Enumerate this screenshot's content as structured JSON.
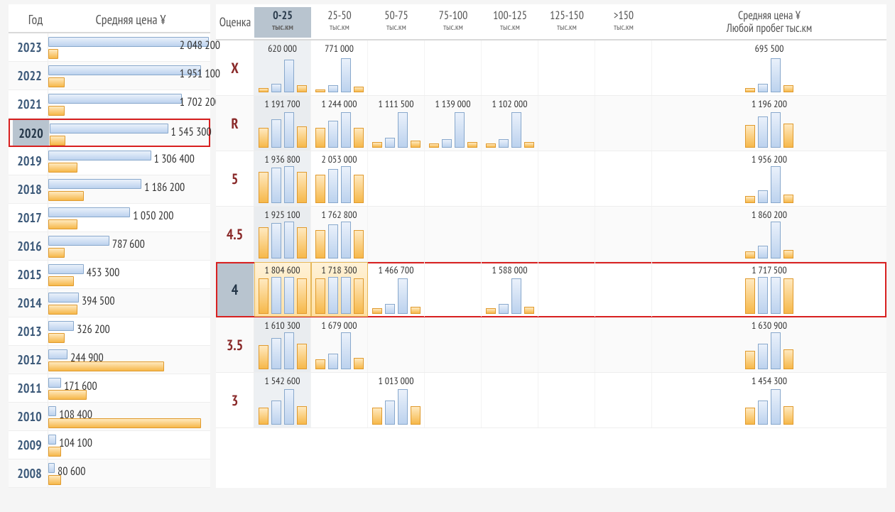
{
  "left": {
    "header": {
      "year": "Год",
      "price": "Средняя цена ¥"
    },
    "selected_year": "2020",
    "max_value": 2048200,
    "rows": [
      {
        "year": "2023",
        "price": 2048200,
        "label": "2 048 200",
        "blue_w": 100,
        "orange_w": 6
      },
      {
        "year": "2022",
        "price": 1951100,
        "label": "1 951 100",
        "blue_w": 95,
        "orange_w": 10
      },
      {
        "year": "2021",
        "price": 1702200,
        "label": "1 702 200",
        "blue_w": 83,
        "orange_w": 10
      },
      {
        "year": "2020",
        "price": 1545300,
        "label": "1 545 300",
        "blue_w": 75,
        "orange_w": 10
      },
      {
        "year": "2019",
        "price": 1306400,
        "label": "1 306 400",
        "blue_w": 64,
        "orange_w": 18
      },
      {
        "year": "2018",
        "price": 1186200,
        "label": "1 186 200",
        "blue_w": 58,
        "orange_w": 22
      },
      {
        "year": "2017",
        "price": 1050200,
        "label": "1 050 200",
        "blue_w": 51,
        "orange_w": 18
      },
      {
        "year": "2016",
        "price": 787600,
        "label": "787 600",
        "blue_w": 38,
        "orange_w": 10
      },
      {
        "year": "2015",
        "price": 453300,
        "label": "453 300",
        "blue_w": 22,
        "orange_w": 16
      },
      {
        "year": "2014",
        "price": 394500,
        "label": "394 500",
        "blue_w": 19,
        "orange_w": 18
      },
      {
        "year": "2013",
        "price": 326200,
        "label": "326 200",
        "blue_w": 16,
        "orange_w": 10
      },
      {
        "year": "2012",
        "price": 244900,
        "label": "244 900",
        "blue_w": 12,
        "orange_w": 72
      },
      {
        "year": "2011",
        "price": 171600,
        "label": "171 600",
        "blue_w": 8,
        "orange_w": 24
      },
      {
        "year": "2010",
        "price": 108400,
        "label": "108 400",
        "blue_w": 5,
        "orange_w": 95
      },
      {
        "year": "2009",
        "price": 104100,
        "label": "104 100",
        "blue_w": 5,
        "orange_w": 8
      },
      {
        "year": "2008",
        "price": 80600,
        "label": "80 600",
        "blue_w": 4,
        "orange_w": 8
      }
    ]
  },
  "grid": {
    "rating_header": "Оценка",
    "avg_header_line1": "Средняя цена ¥",
    "avg_header_line2": "Любой пробег тыс.км",
    "columns": [
      {
        "label": "0-25",
        "sub": "тыс.км",
        "selected": true
      },
      {
        "label": "25-50",
        "sub": "тыс.км",
        "selected": false
      },
      {
        "label": "50-75",
        "sub": "тыс.км",
        "selected": false
      },
      {
        "label": "75-100",
        "sub": "тыс.км",
        "selected": false
      },
      {
        "label": "100-125",
        "sub": "тыс.км",
        "selected": false
      },
      {
        "label": "125-150",
        "sub": "тыс.км",
        "selected": false
      },
      {
        "label": ">150",
        "sub": "тыс.км",
        "selected": false
      }
    ],
    "selected_rating": "4",
    "barcfg": [
      {
        "cls": "o",
        "key": "h0"
      },
      {
        "cls": "b",
        "key": "h1"
      },
      {
        "cls": "b",
        "key": "h2"
      },
      {
        "cls": "o",
        "key": "h3"
      }
    ],
    "rows": [
      {
        "rating": "X",
        "cells": [
          {
            "label": "620 000",
            "h": [
              6,
              12,
              46,
              10
            ]
          },
          {
            "label": "771 000",
            "h": [
              4,
              10,
              48,
              8
            ]
          },
          null,
          null,
          null,
          null,
          null
        ],
        "avg": {
          "label": "695 500",
          "h": [
            6,
            12,
            48,
            10
          ]
        }
      },
      {
        "rating": "R",
        "cells": [
          {
            "label": "1 191 700",
            "h": [
              28,
              40,
              50,
              30
            ]
          },
          {
            "label": "1 244 000",
            "h": [
              28,
              38,
              50,
              28
            ]
          },
          {
            "label": "1 111 500",
            "h": [
              8,
              14,
              50,
              10
            ]
          },
          {
            "label": "1 139 000",
            "h": [
              6,
              12,
              50,
              8
            ]
          },
          {
            "label": "1 102 000",
            "h": [
              6,
              12,
              50,
              8
            ]
          },
          null,
          null
        ],
        "avg": {
          "label": "1 196 200",
          "h": [
            32,
            44,
            50,
            34
          ]
        }
      },
      {
        "rating": "5",
        "cells": [
          {
            "label": "1 936 800",
            "h": [
              44,
              50,
              52,
              44
            ]
          },
          {
            "label": "2 053 000",
            "h": [
              40,
              48,
              52,
              40
            ]
          },
          null,
          null,
          null,
          null,
          null
        ],
        "avg": {
          "label": "1 956 200",
          "h": [
            10,
            18,
            52,
            12
          ]
        }
      },
      {
        "rating": "4.5",
        "cells": [
          {
            "label": "1 925 100",
            "h": [
              44,
              50,
              52,
              44
            ]
          },
          {
            "label": "1 762 800",
            "h": [
              40,
              48,
              52,
              40
            ]
          },
          null,
          null,
          null,
          null,
          null
        ],
        "avg": {
          "label": "1 860 200",
          "h": [
            10,
            18,
            52,
            12
          ]
        }
      },
      {
        "rating": "4",
        "cells": [
          {
            "label": "1 804 600",
            "h": [
              50,
              52,
              52,
              50
            ],
            "hl": true
          },
          {
            "label": "1 718 300",
            "h": [
              50,
              52,
              52,
              50
            ],
            "hl": true
          },
          {
            "label": "1 466 700",
            "h": [
              8,
              14,
              50,
              10
            ]
          },
          null,
          {
            "label": "1 588 000",
            "h": [
              8,
              14,
              50,
              10
            ]
          },
          null,
          null
        ],
        "avg": {
          "label": "1 717 500",
          "h": [
            50,
            52,
            52,
            50
          ]
        }
      },
      {
        "rating": "3.5",
        "cells": [
          {
            "label": "1 610 300",
            "h": [
              34,
              44,
              52,
              36
            ]
          },
          {
            "label": "1 679 000",
            "h": [
              14,
              22,
              52,
              16
            ]
          },
          null,
          null,
          null,
          null,
          null
        ],
        "avg": {
          "label": "1 630 900",
          "h": [
            26,
            36,
            52,
            28
          ]
        }
      },
      {
        "rating": "3",
        "cells": [
          {
            "label": "1 542 600",
            "h": [
              24,
              34,
              50,
              26
            ]
          },
          null,
          {
            "label": "1 013 000",
            "h": [
              24,
              34,
              50,
              26
            ]
          },
          null,
          null,
          null,
          null
        ],
        "avg": {
          "label": "1 454 300",
          "h": [
            24,
            34,
            50,
            26
          ]
        }
      }
    ]
  },
  "chart_data": {
    "type": "table",
    "title": "Средняя цена ¥ по году, оценке и пробегу",
    "by_year": [
      {
        "year": 2023,
        "avg_price": 2048200
      },
      {
        "year": 2022,
        "avg_price": 1951100
      },
      {
        "year": 2021,
        "avg_price": 1702200
      },
      {
        "year": 2020,
        "avg_price": 1545300
      },
      {
        "year": 2019,
        "avg_price": 1306400
      },
      {
        "year": 2018,
        "avg_price": 1186200
      },
      {
        "year": 2017,
        "avg_price": 1050200
      },
      {
        "year": 2016,
        "avg_price": 787600
      },
      {
        "year": 2015,
        "avg_price": 453300
      },
      {
        "year": 2014,
        "avg_price": 394500
      },
      {
        "year": 2013,
        "avg_price": 326200
      },
      {
        "year": 2012,
        "avg_price": 244900
      },
      {
        "year": 2011,
        "avg_price": 171600
      },
      {
        "year": 2010,
        "avg_price": 108400
      },
      {
        "year": 2009,
        "avg_price": 104100
      },
      {
        "year": 2008,
        "avg_price": 80600
      }
    ],
    "by_rating_mileage": {
      "mileage_bins_km_thousands": [
        "0-25",
        "25-50",
        "50-75",
        "75-100",
        "100-125",
        "125-150",
        ">150"
      ],
      "rows": [
        {
          "rating": "X",
          "values": [
            620000,
            771000,
            null,
            null,
            null,
            null,
            null
          ],
          "any_mileage": 695500
        },
        {
          "rating": "R",
          "values": [
            1191700,
            1244000,
            1111500,
            1139000,
            1102000,
            null,
            null
          ],
          "any_mileage": 1196200
        },
        {
          "rating": "5",
          "values": [
            1936800,
            2053000,
            null,
            null,
            null,
            null,
            null
          ],
          "any_mileage": 1956200
        },
        {
          "rating": "4.5",
          "values": [
            1925100,
            1762800,
            null,
            null,
            null,
            null,
            null
          ],
          "any_mileage": 1860200
        },
        {
          "rating": "4",
          "values": [
            1804600,
            1718300,
            1466700,
            null,
            1588000,
            null,
            null
          ],
          "any_mileage": 1717500
        },
        {
          "rating": "3.5",
          "values": [
            1610300,
            1679000,
            null,
            null,
            null,
            null,
            null
          ],
          "any_mileage": 1630900
        },
        {
          "rating": "3",
          "values": [
            1542600,
            null,
            1013000,
            null,
            null,
            null,
            null
          ],
          "any_mileage": 1454300
        }
      ]
    },
    "selected": {
      "year": 2020,
      "rating": "4",
      "mileage_bin": "0-25"
    }
  }
}
